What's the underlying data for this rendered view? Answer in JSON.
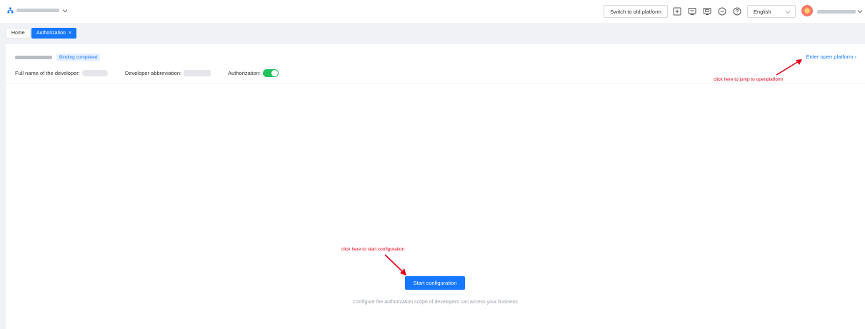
{
  "header": {
    "switch_label": "Switch to old platform",
    "language": "English",
    "icons": [
      "org-chart-icon",
      "plus-square-icon",
      "message-icon",
      "screen-icon",
      "minus-circle-icon",
      "help-icon",
      "chevron-down-icon"
    ]
  },
  "tabs": [
    {
      "label": "Home"
    },
    {
      "label": "Authorization",
      "active": true,
      "close": "×"
    }
  ],
  "panel": {
    "status_badge": "Binding completed",
    "open_link": "Enter open platform",
    "open_link_arrow": "›",
    "full_name_label": "Full name of the developer:",
    "abbreviation_label": "Developer abbreviation:",
    "authorization_label": "Authorization:",
    "authorization_enabled": true
  },
  "annotations": {
    "jump": "click here to jump to openplatform",
    "start": "click here to start configuration"
  },
  "main": {
    "start_button": "Start configuration",
    "hint": "Configure the authorization scope of developers can access your business"
  },
  "colors": {
    "primary": "#1677ff",
    "toggle_on": "#21c25e",
    "annotation": "#e0001a"
  }
}
